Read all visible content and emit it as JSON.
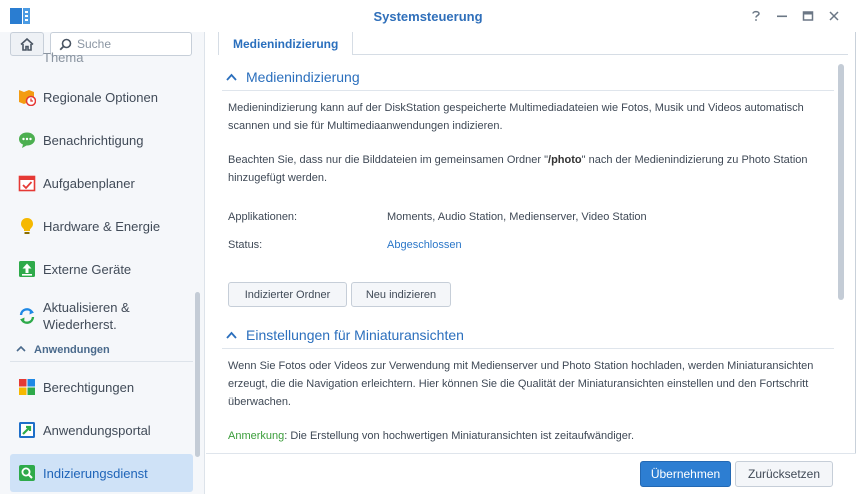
{
  "window": {
    "title": "Systemsteuerung",
    "controls": [
      "help-icon",
      "minimize-icon",
      "maximize-icon",
      "close-icon"
    ]
  },
  "sidebar": {
    "search_placeholder": "Suche",
    "partial_item": "Thema",
    "items": [
      {
        "label": "Regionale Optionen",
        "icon": "regional-options-icon",
        "color": "#f39c12"
      },
      {
        "label": "Benachrichtigung",
        "icon": "notification-icon",
        "color": "#4caf50"
      },
      {
        "label": "Aufgabenplaner",
        "icon": "task-scheduler-icon",
        "color": "#e53935"
      },
      {
        "label": "Hardware & Energie",
        "icon": "lightbulb-icon",
        "color": "#f5b800"
      },
      {
        "label": "Externe Geräte",
        "icon": "external-devices-icon",
        "color": "#2eaa4a"
      },
      {
        "label": "Aktualisieren & Wiederherst.",
        "icon": "update-restore-icon",
        "color": "#1e88e5"
      }
    ],
    "group": "Anwendungen",
    "app_items": [
      {
        "label": "Berechtigungen",
        "icon": "privileges-icon"
      },
      {
        "label": "Anwendungsportal",
        "icon": "application-portal-icon"
      },
      {
        "label": "Indizierungsdienst",
        "icon": "indexing-service-icon",
        "active": true
      }
    ]
  },
  "tabs": [
    {
      "label": "Medienindizierung",
      "active": true
    }
  ],
  "section1": {
    "title": "Medienindizierung",
    "para1": "Medienindizierung kann auf der DiskStation gespeicherte Multimediadateien wie Fotos, Musik und Videos automatisch scannen und sie für Multimediaanwendungen indizieren.",
    "para2_pre": "Beachten Sie, dass nur die Bilddateien im gemeinsamen Ordner \"",
    "para2_bold": "/photo",
    "para2_post": "\" nach der Medienindizierung zu Photo Station hinzugefügt werden.",
    "applications_label": "Applikationen:",
    "applications_value": "Moments, Audio Station, Medienserver, Video Station",
    "status_label": "Status:",
    "status_value": "Abgeschlossen",
    "btn_indexed_folder": "Indizierter Ordner",
    "btn_reindex": "Neu indizieren"
  },
  "section2": {
    "title": "Einstellungen für Miniaturansichten",
    "para": "Wenn Sie Fotos oder Videos zur Verwendung mit Medienserver und Photo Station hochladen, werden Miniaturansichten erzeugt, die die Navigation erleichtern. Hier können Sie die Qualität der Miniaturansichten einstellen und den Fortschritt überwachen.",
    "note_label": "Anmerkung",
    "note_text": ": Die Erstellung von hochwertigen Miniaturansichten ist zeitaufwändiger."
  },
  "footer": {
    "apply": "Übernehmen",
    "reset": "Zurücksetzen"
  },
  "colors": {
    "accent": "#2d7ed2",
    "active_bg": "#cfe2f7",
    "note": "#3a9d3a"
  }
}
